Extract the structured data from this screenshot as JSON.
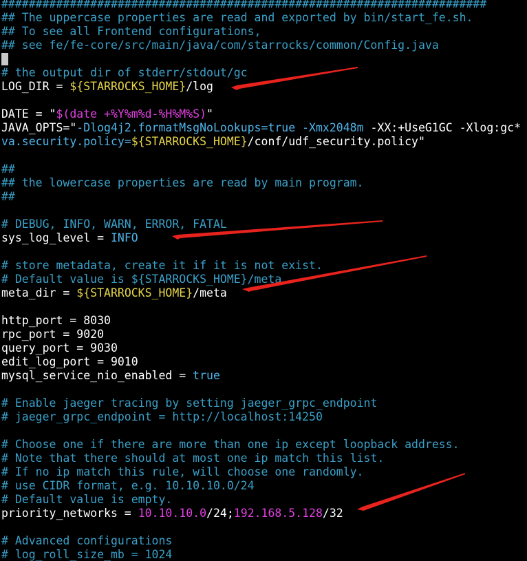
{
  "lines": {
    "l0": "#######################################################################",
    "l1": "## The uppercase properties are read and exported by bin/start_fe.sh.",
    "l2": "## To see all Frontend configurations,",
    "l3": "## see fe/fe-core/src/main/java/com/starrocks/common/Config.java",
    "l5": "# the output dir of stderr/stdout/gc",
    "l6_key": "LOG_DIR = ",
    "l6_var": "${STARROCKS_HOME}",
    "l6_rest": "/log",
    "l8_key": "DATE = ",
    "l8_q1": "\"",
    "l8_str": "$(date +%Y%m%d-%H%M%S)",
    "l8_q2": "\"",
    "l9_key": "JAVA_OPTS=",
    "l9_q": "\"",
    "l9_a": "-Dlog4j2.formatMsgNoLookups=",
    "l9_true": "true",
    "l9_b": " ",
    "l9_xmx": "-Xmx2048m",
    "l9_c": " -XX:+UseG1GC -Xlog:gc*",
    "l10_a": "va.security.policy=",
    "l10_var": "${STARROCKS_HOME}",
    "l10_b": "/conf/udf_security.policy\"",
    "l12": "##",
    "l13": "## the lowercase properties are read by main program.",
    "l14": "##",
    "l16": "# DEBUG, INFO, WARN, ERROR, FATAL",
    "l17_key": "sys_log_level = ",
    "l17_val": "INFO",
    "l19": "# store metadata, create it if it is not exist.",
    "l20": "# Default value is ${STARROCKS_HOME}/meta",
    "l21_key": "meta_dir = ",
    "l21_var": "${STARROCKS_HOME}",
    "l21_rest": "/meta",
    "l23": "http_port = 8030",
    "l24": "rpc_port = 9020",
    "l25": "query_port = 9030",
    "l26": "edit_log_port = 9010",
    "l27_key": "mysql_service_nio_enabled = ",
    "l27_val": "true",
    "l29": "# Enable jaeger tracing by setting jaeger_grpc_endpoint",
    "l30": "# jaeger_grpc_endpoint = http://localhost:14250",
    "l32": "# Choose one if there are more than one ip except loopback address.",
    "l33": "# Note that there should at most one ip match this list.",
    "l34": "# If no ip match this rule, will choose one randomly.",
    "l35": "# use CIDR format, e.g. 10.10.10.0/24",
    "l36": "# Default value is empty.",
    "l37_key": "priority_networks = ",
    "l37_ip1": "10.10.10.0",
    "l37_mid": "/24;",
    "l37_ip2": "192.168.5.128",
    "l37_end": "/32",
    "l39": "# Advanced configurations",
    "l40": "# log_roll_size_mb = 1024"
  },
  "colors": {
    "background": "#000000",
    "comment": "#3aa0c8",
    "variable": "#e6d44a",
    "number": "#e040e0",
    "keyword": "#4fb3e8",
    "annotation_arrow": "#e8231e"
  }
}
